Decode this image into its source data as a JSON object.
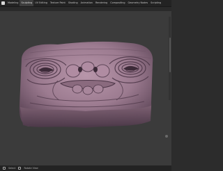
{
  "menu": {
    "tabs": [
      {
        "label": "Modeling"
      },
      {
        "label": "Sculpting"
      },
      {
        "label": "UV Editing"
      },
      {
        "label": "Texture Paint"
      },
      {
        "label": "Shading"
      },
      {
        "label": "Animation"
      },
      {
        "label": "Rendering"
      },
      {
        "label": "Compositing"
      },
      {
        "label": "Geometry Nodes"
      },
      {
        "label": "Scripting"
      }
    ]
  },
  "status": {
    "left_text": "Select",
    "right_text": "Rotate View"
  },
  "colors": {
    "background": "#2c2c2c",
    "viewport": "#3b3b3b",
    "model": "#a48498"
  }
}
